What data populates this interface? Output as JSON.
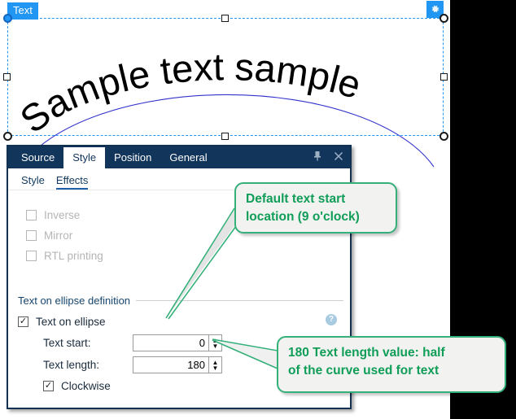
{
  "canvas": {
    "selection_badge": "Text",
    "art_text": "Sample text sample",
    "gear_icon": "gear-icon"
  },
  "dialog": {
    "tabs": [
      {
        "label": "Source",
        "active": false
      },
      {
        "label": "Style",
        "active": true
      },
      {
        "label": "Position",
        "active": false
      },
      {
        "label": "General",
        "active": false
      }
    ],
    "title_buttons": [
      {
        "name": "pin-icon",
        "glyph": "▼"
      },
      {
        "name": "close-icon",
        "glyph": "✕"
      }
    ],
    "subtabs": [
      {
        "label": "Style",
        "active": false
      },
      {
        "label": "Effects",
        "active": true
      }
    ],
    "effect_checks": [
      {
        "label": "Inverse",
        "checked": false,
        "enabled": false
      },
      {
        "label": "Mirror",
        "checked": false,
        "enabled": false
      },
      {
        "label": "RTL printing",
        "checked": false,
        "enabled": false
      }
    ],
    "group": {
      "title": "Text on ellipse definition",
      "help_icon": "help-icon",
      "text_on_ellipse": {
        "label": "Text on ellipse",
        "checked": true
      },
      "fields": [
        {
          "label": "Text start:",
          "value": "0"
        },
        {
          "label": "Text length:",
          "value": "180"
        }
      ],
      "clockwise": {
        "label": "Clockwise",
        "checked": true
      }
    }
  },
  "callouts": [
    {
      "id": "callout-1",
      "line1": "Default text start",
      "line2": "location (9 o'clock)"
    },
    {
      "id": "callout-2",
      "line1": "180 Text length value: half",
      "line2": "of the curve used for text"
    }
  ],
  "colors": {
    "accent_blue": "#2196f3",
    "titlebar_navy": "#12355b",
    "callout_green": "#0f9d58",
    "callout_border": "#35b07a",
    "ellipse_guide": "#3333cc"
  }
}
